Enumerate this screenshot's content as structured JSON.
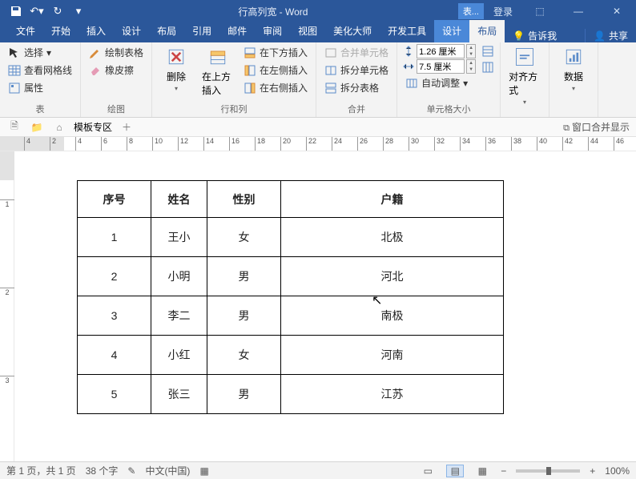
{
  "title": "行高列宽  -  Word",
  "context_tab": "表...",
  "login": "登录",
  "tabs": [
    "文件",
    "开始",
    "插入",
    "设计",
    "布局",
    "引用",
    "邮件",
    "审阅",
    "视图",
    "美化大师",
    "开发工具",
    "设计",
    "布局"
  ],
  "active_tab": 12,
  "tell_me": "告诉我",
  "share": "共享",
  "ribbon": {
    "g_table": {
      "label": "表",
      "select": "选择",
      "gridlines": "查看网格线",
      "props": "属性"
    },
    "g_draw": {
      "label": "绘图",
      "draw": "绘制表格",
      "eraser": "橡皮擦"
    },
    "g_rowscols": {
      "label": "行和列",
      "delete": "删除",
      "insert_above": "在上方插入",
      "insert_below": "在下方插入",
      "insert_left": "在左侧插入",
      "insert_right": "在右侧插入"
    },
    "g_merge": {
      "label": "合并",
      "merge": "合并单元格",
      "split": "拆分单元格",
      "split_table": "拆分表格"
    },
    "g_cellsize": {
      "label": "单元格大小",
      "height": "1.26 厘米",
      "width": "7.5 厘米",
      "autofit": "自动调整"
    },
    "g_align": {
      "label": "对齐方式"
    },
    "g_data": {
      "label": "数据"
    }
  },
  "subbar": {
    "templates": "模板专区",
    "merge_display": "窗口合并显示"
  },
  "ruler_h": [
    4,
    2,
    4,
    6,
    8,
    10,
    12,
    14,
    16,
    18,
    20,
    22,
    24,
    26,
    28,
    30,
    32,
    34,
    36,
    38,
    40,
    42,
    44,
    46
  ],
  "ruler_v": [
    1,
    2,
    3
  ],
  "table": {
    "headers": [
      "序号",
      "姓名",
      "性别",
      "户籍"
    ],
    "rows": [
      [
        "1",
        "王小",
        "女",
        "北极"
      ],
      [
        "2",
        "小明",
        "男",
        "河北"
      ],
      [
        "3",
        "李二",
        "男",
        "南极"
      ],
      [
        "4",
        "小红",
        "女",
        "河南"
      ],
      [
        "5",
        "张三",
        "男",
        "江苏"
      ]
    ]
  },
  "status": {
    "page": "第 1 页，共 1 页",
    "words": "38 个字",
    "lang": "中文(中国)",
    "zoom": "100%"
  }
}
